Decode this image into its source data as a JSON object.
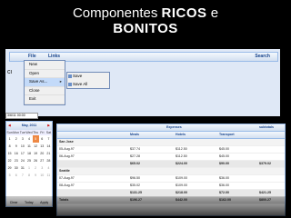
{
  "title": {
    "part1": "Componentes",
    "part2": "RICOS",
    "part3": "e",
    "line2": "BONITOS"
  },
  "menubar": {
    "file": "File",
    "links": "Links",
    "search": "Search"
  },
  "file_menu": [
    {
      "label": "New"
    },
    {
      "label": "Open"
    },
    {
      "label": "Save As...",
      "submenu": true
    },
    {
      "label": "Close"
    },
    {
      "label": "Exit"
    }
  ],
  "submenu": [
    {
      "label": "Save"
    },
    {
      "label": "Save All"
    }
  ],
  "left_letter": "Cl",
  "date_value": "3/6/11 00:00",
  "calendar": {
    "month": "May, 2011",
    "dow": [
      "Sun",
      "Mon",
      "Tue",
      "Wed",
      "Thu",
      "Fri",
      "Sat"
    ],
    "weeks": [
      [
        "1",
        "2",
        "3",
        "4",
        "5",
        "6",
        "7"
      ],
      [
        "8",
        "9",
        "10",
        "11",
        "12",
        "13",
        "14"
      ],
      [
        "15",
        "16",
        "17",
        "18",
        "19",
        "20",
        "21"
      ],
      [
        "22",
        "23",
        "24",
        "25",
        "26",
        "27",
        "28"
      ],
      [
        "29",
        "30",
        "31",
        "1",
        "2",
        "3",
        "4"
      ],
      [
        "5",
        "6",
        "7",
        "8",
        "9",
        "10",
        "11"
      ]
    ],
    "today_index": [
      0,
      4
    ],
    "clear": "Clear",
    "today": "Today",
    "apply": "Apply"
  },
  "grid": {
    "headers": {
      "expenses": "Expenses",
      "meals": "Meals",
      "hotels": "Hotels",
      "transport": "Transport",
      "subtotals": "subtotals"
    },
    "rows": [
      {
        "type": "group",
        "c1": "San Jose"
      },
      {
        "type": "row",
        "c1": "05-Aug-97",
        "c2": "$37.74",
        "c3": "$112.50",
        "c4": "$45.00",
        "c5": ""
      },
      {
        "type": "row",
        "c1": "06-Aug-97",
        "c2": "$27.28",
        "c3": "$112.50",
        "c4": "$45.00",
        "c5": ""
      },
      {
        "type": "sum",
        "c1": "",
        "c2": "$65.02",
        "c3": "$224.00",
        "c4": "$90.00",
        "c5": "$379.02"
      },
      {
        "type": "group",
        "c1": "Seattle"
      },
      {
        "type": "row",
        "c1": "07-Aug-97",
        "c2": "$96.50",
        "c3": "$109.00",
        "c4": "$36.00",
        "c5": ""
      },
      {
        "type": "row",
        "c1": "08-Aug-97",
        "c2": "$35.02",
        "c3": "$109.00",
        "c4": "$36.00",
        "c5": ""
      },
      {
        "type": "sum",
        "c1": "",
        "c2": "$131.25",
        "c3": "$218.00",
        "c4": "$72.00",
        "c5": "$421.25"
      },
      {
        "type": "total",
        "c1": "Totals",
        "c2": "$196.27",
        "c3": "$442.00",
        "c4": "$162.00",
        "c5": "$800.27"
      }
    ]
  }
}
